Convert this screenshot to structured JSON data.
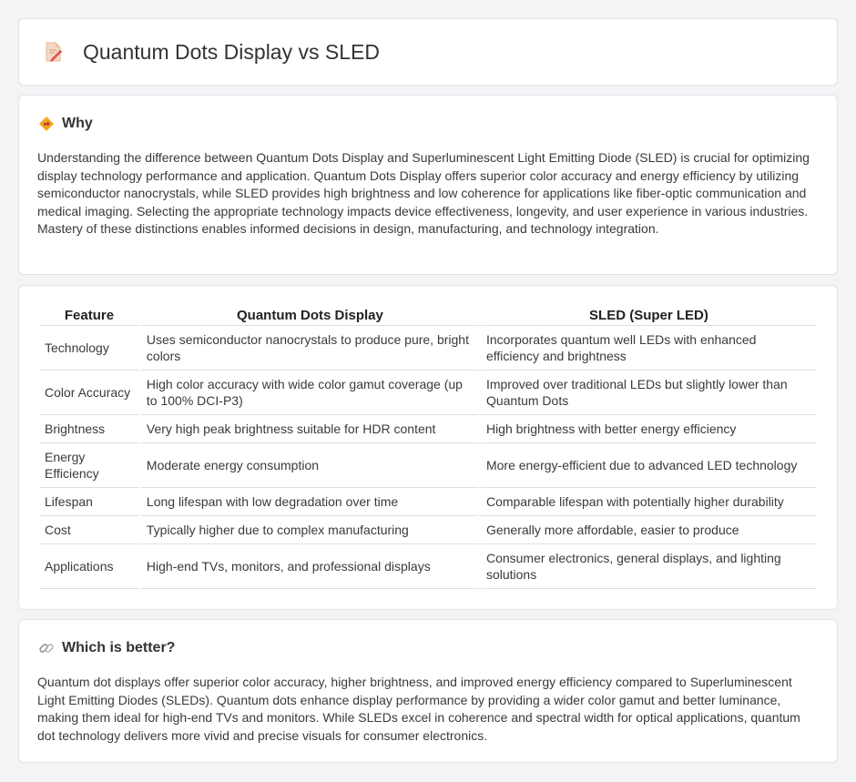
{
  "page": {
    "title": "Quantum Dots Display vs SLED"
  },
  "why": {
    "heading": "Why",
    "text": "Understanding the difference between Quantum Dots Display and Superluminescent Light Emitting Diode (SLED) is crucial for optimizing display technology performance and application. Quantum Dots Display offers superior color accuracy and energy efficiency by utilizing semiconductor nanocrystals, while SLED provides high brightness and low coherence for applications like fiber-optic communication and medical imaging. Selecting the appropriate technology impacts device effectiveness, longevity, and user experience in various industries. Mastery of these distinctions enables informed decisions in design, manufacturing, and technology integration."
  },
  "comparison": {
    "headers": [
      "Feature",
      "Quantum Dots Display",
      "SLED (Super LED)"
    ],
    "rows": [
      [
        "Technology",
        "Uses semiconductor nanocrystals to produce pure, bright colors",
        "Incorporates quantum well LEDs with enhanced efficiency and brightness"
      ],
      [
        "Color Accuracy",
        "High color accuracy with wide color gamut coverage (up to 100% DCI-P3)",
        "Improved over traditional LEDs but slightly lower than Quantum Dots"
      ],
      [
        "Brightness",
        "Very high peak brightness suitable for HDR content",
        "High brightness with better energy efficiency"
      ],
      [
        "Energy Efficiency",
        "Moderate energy consumption",
        "More energy-efficient due to advanced LED technology"
      ],
      [
        "Lifespan",
        "Long lifespan with low degradation over time",
        "Comparable lifespan with potentially higher durability"
      ],
      [
        "Cost",
        "Typically higher due to complex manufacturing",
        "Generally more affordable, easier to produce"
      ],
      [
        "Applications",
        "High-end TVs, monitors, and professional displays",
        "Consumer electronics, general displays, and lighting solutions"
      ]
    ]
  },
  "better": {
    "heading": "Which is better?",
    "text": "Quantum dot displays offer superior color accuracy, higher brightness, and improved energy efficiency compared to Superluminescent Light Emitting Diodes (SLEDs). Quantum dots enhance display performance by providing a wider color gamut and better luminance, making them ideal for high-end TVs and monitors. While SLEDs excel in coherence and spectral width for optical applications, quantum dot technology delivers more vivid and precise visuals for consumer electronics."
  },
  "icons": {
    "title": "document-pencil-icon",
    "why": "diamond-direction-icon",
    "better": "link-icon"
  },
  "colors": {
    "page_bg": "#f3f4f6",
    "card_bg": "#ffffff",
    "text": "#333333",
    "accent_orange": "#f0a030"
  }
}
